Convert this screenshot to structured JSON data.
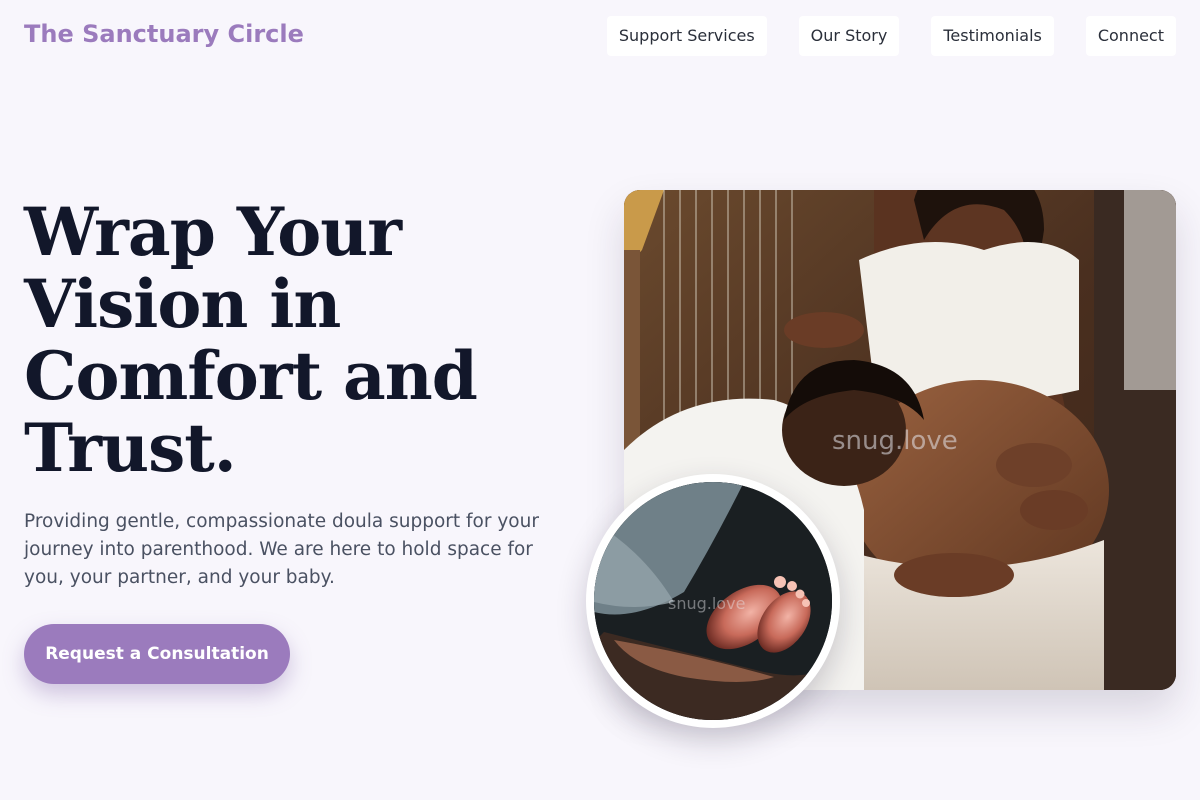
{
  "header": {
    "logo": "The Sanctuary Circle",
    "nav": [
      "Support Services",
      "Our Story",
      "Testimonials",
      "Connect"
    ]
  },
  "hero": {
    "title": "Wrap Your Vision in Comfort and Trust.",
    "subtitle": "Providing gentle, compassionate doula support for your journey into parenthood. We are here to hold space for you, your partner, and your baby.",
    "cta": "Request a Consultation"
  },
  "images": {
    "main_watermark": "snug.love",
    "circle_watermark": "snug.love"
  },
  "colors": {
    "accent": "#9b7bbd",
    "background": "#f8f6fc",
    "heading": "#12172a"
  }
}
